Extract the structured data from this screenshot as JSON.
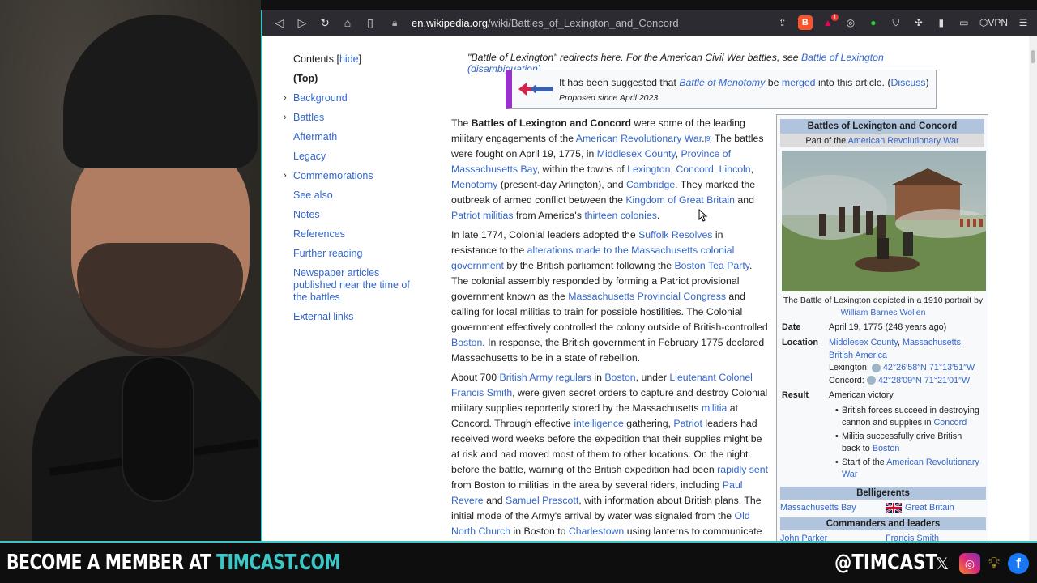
{
  "browser": {
    "url_host": "en.wikipedia.org",
    "url_path": "/wiki/Battles_of_Lexington_and_Concord",
    "vpn_label": "VPN",
    "brave_badge": "B",
    "notif_count": "1"
  },
  "toc": {
    "title": "Contents",
    "hide_label": "hide",
    "items": [
      {
        "label": "(Top)"
      },
      {
        "label": "Background"
      },
      {
        "label": "Battles"
      },
      {
        "label": "Aftermath"
      },
      {
        "label": "Legacy"
      },
      {
        "label": "Commemorations"
      },
      {
        "label": "See also"
      },
      {
        "label": "Notes"
      },
      {
        "label": "References"
      },
      {
        "label": "Further reading"
      },
      {
        "label": "Newspaper articles published near the time of the battles"
      },
      {
        "label": "External links"
      }
    ]
  },
  "hatnote": {
    "text": "\"Battle of Lexington\" redirects here. For the American Civil War battles, see ",
    "link": "Battle of Lexington (disambiguation)",
    "end": "."
  },
  "mbox": {
    "p1": "It has been suggested that ",
    "link1": "Battle of Menotomy",
    "p2": " be ",
    "link2": "merged",
    "p3": " into this article. (",
    "link3": "Discuss",
    "p4": ")",
    "since": "Proposed since April 2023."
  },
  "infobox": {
    "title": "Battles of Lexington and Concord",
    "subtitle_pre": "Part of the ",
    "subtitle_link": "American Revolutionary War",
    "caption_pre": "The Battle of Lexington depicted in a 1910 portrait by ",
    "caption_link": "William Barnes Wollen",
    "date_label": "Date",
    "date_value": "April 19, 1775 (248 years ago)",
    "location_label": "Location",
    "loc_link1": "Middlesex County",
    "loc_link2": "Massachusetts",
    "loc_link3": "British America",
    "lex_label": "Lexington:",
    "lex_coord": "42°26′58″N 71°13′51″W",
    "con_label": "Concord:",
    "con_coord": "42°28′09″N 71°21′01″W",
    "result_label": "Result",
    "result_value": "American victory",
    "b1_pre": "British forces succeed in destroying cannon and supplies in ",
    "b1_link": "Concord",
    "b2_pre": "Militia successfully drive British back to ",
    "b2_link": "Boston",
    "b3_pre": "Start of the ",
    "b3_link": "American Revolutionary War",
    "belligerents": "Belligerents",
    "bel_left": "Massachusetts Bay",
    "bel_right": "Great Britain",
    "commanders": "Commanders and leaders",
    "cmd_left": "John Parker",
    "cmd_right": "Francis Smith"
  },
  "overlay": {
    "cta_white": "BECOME A MEMBER AT ",
    "cta_teal": "TIMCAST.COM",
    "handle": "@TIMCAST",
    "icons": [
      "x-icon",
      "instagram-icon",
      "lightbulb-icon",
      "facebook-icon"
    ]
  },
  "colors": {
    "link": "#3366cc",
    "accent": "#3cc6c6",
    "infobox_header": "#b0c4de",
    "mbox_border": "#9932cc"
  }
}
